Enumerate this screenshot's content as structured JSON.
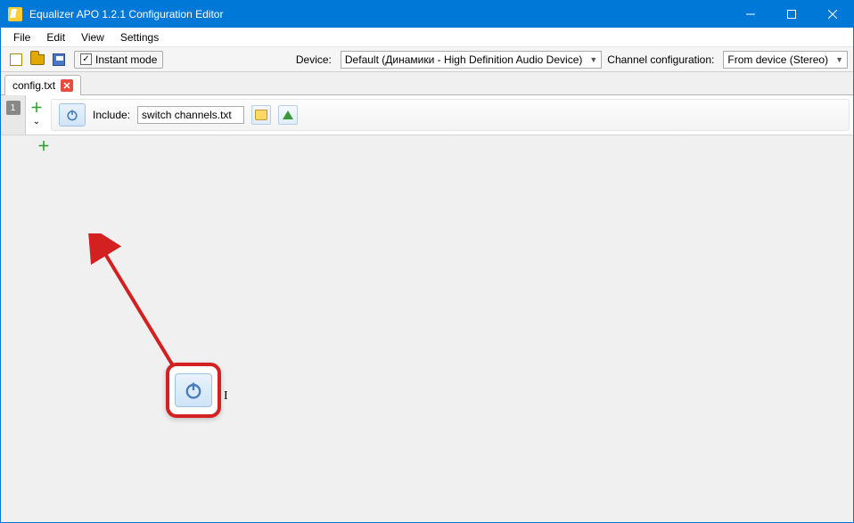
{
  "window": {
    "title": "Equalizer APO 1.2.1 Configuration Editor"
  },
  "menu": {
    "file": "File",
    "edit": "Edit",
    "view": "View",
    "settings": "Settings"
  },
  "toolbar": {
    "instant_mode": "Instant mode",
    "instant_mode_checked": "true",
    "device_label": "Device:",
    "device_value": "Default (Динамики - High Definition Audio Device)",
    "channel_label": "Channel configuration:",
    "channel_value": "From device (Stereo)"
  },
  "tabs": {
    "tab1": "config.txt"
  },
  "rows": {
    "r1": {
      "num": "1",
      "include_label": "Include:",
      "include_value": "switch channels.txt"
    }
  },
  "annotation": {
    "cursor_sample": "I"
  }
}
